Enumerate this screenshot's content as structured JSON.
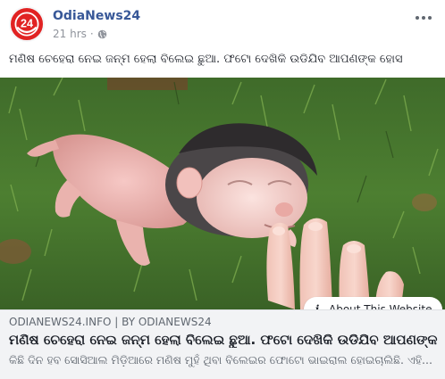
{
  "page": {
    "name": "OdiaNews24",
    "timestamp": "21 hrs",
    "separator": "·",
    "privacy_icon": "globe-icon",
    "logo_text": "24"
  },
  "post": {
    "caption": "ମଣିଷ ଚେହେରା ନେଇ ଜନ୍ମ ହେଲା ବିଲେଇ ଛୁଆ. ଫଟୋ ଦେଖିକି ଉଡିଯିବ ଆପଣଙ୍କ ହୋସ"
  },
  "media": {
    "about_label": "About This Website",
    "about_icon": "info-icon"
  },
  "link_card": {
    "domain": "ODIANEWS24.INFO",
    "byline_sep": "|",
    "byline": "BY ODIANEWS24",
    "title": "ମଣିଷ ଚେହେରା ନେଇ ଜନ୍ମ ହେଲା ବିଲେଇ ଛୁଆ. ଫଟୋ ଦେଖିକି ଉଡିଯିବ ଆପଣଙ୍କ ହୋସ",
    "description": "କିଛି ଦିନ ହବ ସୋସିଆଲ ମିଡ଼ିଆରେ ମଣିଷ ମୁହଁ ଥିବା ବିଲେଇର ଫୋଟୋ ଭାଇରାଲ ହୋଇଚାଲିଛି. ଏହି..."
  },
  "colors": {
    "page_name": "#385898",
    "brand_red": "#e12323",
    "card_bg": "#f2f3f5",
    "meta_text": "#90949c"
  }
}
